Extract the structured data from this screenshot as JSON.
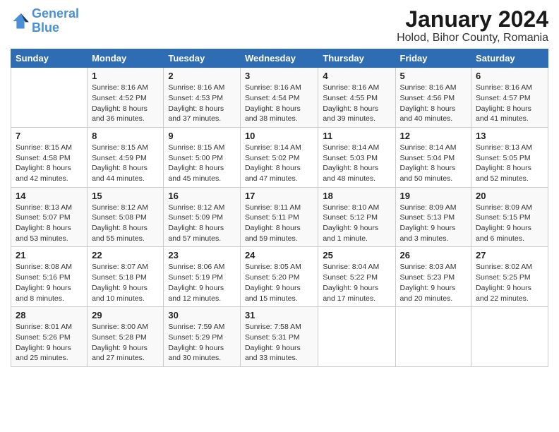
{
  "logo": {
    "line1": "General",
    "line2": "Blue"
  },
  "title": "January 2024",
  "subtitle": "Holod, Bihor County, Romania",
  "weekdays": [
    "Sunday",
    "Monday",
    "Tuesday",
    "Wednesday",
    "Thursday",
    "Friday",
    "Saturday"
  ],
  "weeks": [
    [
      {
        "day": "",
        "info": ""
      },
      {
        "day": "1",
        "info": "Sunrise: 8:16 AM\nSunset: 4:52 PM\nDaylight: 8 hours\nand 36 minutes."
      },
      {
        "day": "2",
        "info": "Sunrise: 8:16 AM\nSunset: 4:53 PM\nDaylight: 8 hours\nand 37 minutes."
      },
      {
        "day": "3",
        "info": "Sunrise: 8:16 AM\nSunset: 4:54 PM\nDaylight: 8 hours\nand 38 minutes."
      },
      {
        "day": "4",
        "info": "Sunrise: 8:16 AM\nSunset: 4:55 PM\nDaylight: 8 hours\nand 39 minutes."
      },
      {
        "day": "5",
        "info": "Sunrise: 8:16 AM\nSunset: 4:56 PM\nDaylight: 8 hours\nand 40 minutes."
      },
      {
        "day": "6",
        "info": "Sunrise: 8:16 AM\nSunset: 4:57 PM\nDaylight: 8 hours\nand 41 minutes."
      }
    ],
    [
      {
        "day": "7",
        "info": "Sunrise: 8:15 AM\nSunset: 4:58 PM\nDaylight: 8 hours\nand 42 minutes."
      },
      {
        "day": "8",
        "info": "Sunrise: 8:15 AM\nSunset: 4:59 PM\nDaylight: 8 hours\nand 44 minutes."
      },
      {
        "day": "9",
        "info": "Sunrise: 8:15 AM\nSunset: 5:00 PM\nDaylight: 8 hours\nand 45 minutes."
      },
      {
        "day": "10",
        "info": "Sunrise: 8:14 AM\nSunset: 5:02 PM\nDaylight: 8 hours\nand 47 minutes."
      },
      {
        "day": "11",
        "info": "Sunrise: 8:14 AM\nSunset: 5:03 PM\nDaylight: 8 hours\nand 48 minutes."
      },
      {
        "day": "12",
        "info": "Sunrise: 8:14 AM\nSunset: 5:04 PM\nDaylight: 8 hours\nand 50 minutes."
      },
      {
        "day": "13",
        "info": "Sunrise: 8:13 AM\nSunset: 5:05 PM\nDaylight: 8 hours\nand 52 minutes."
      }
    ],
    [
      {
        "day": "14",
        "info": "Sunrise: 8:13 AM\nSunset: 5:07 PM\nDaylight: 8 hours\nand 53 minutes."
      },
      {
        "day": "15",
        "info": "Sunrise: 8:12 AM\nSunset: 5:08 PM\nDaylight: 8 hours\nand 55 minutes."
      },
      {
        "day": "16",
        "info": "Sunrise: 8:12 AM\nSunset: 5:09 PM\nDaylight: 8 hours\nand 57 minutes."
      },
      {
        "day": "17",
        "info": "Sunrise: 8:11 AM\nSunset: 5:11 PM\nDaylight: 8 hours\nand 59 minutes."
      },
      {
        "day": "18",
        "info": "Sunrise: 8:10 AM\nSunset: 5:12 PM\nDaylight: 9 hours\nand 1 minute."
      },
      {
        "day": "19",
        "info": "Sunrise: 8:09 AM\nSunset: 5:13 PM\nDaylight: 9 hours\nand 3 minutes."
      },
      {
        "day": "20",
        "info": "Sunrise: 8:09 AM\nSunset: 5:15 PM\nDaylight: 9 hours\nand 6 minutes."
      }
    ],
    [
      {
        "day": "21",
        "info": "Sunrise: 8:08 AM\nSunset: 5:16 PM\nDaylight: 9 hours\nand 8 minutes."
      },
      {
        "day": "22",
        "info": "Sunrise: 8:07 AM\nSunset: 5:18 PM\nDaylight: 9 hours\nand 10 minutes."
      },
      {
        "day": "23",
        "info": "Sunrise: 8:06 AM\nSunset: 5:19 PM\nDaylight: 9 hours\nand 12 minutes."
      },
      {
        "day": "24",
        "info": "Sunrise: 8:05 AM\nSunset: 5:20 PM\nDaylight: 9 hours\nand 15 minutes."
      },
      {
        "day": "25",
        "info": "Sunrise: 8:04 AM\nSunset: 5:22 PM\nDaylight: 9 hours\nand 17 minutes."
      },
      {
        "day": "26",
        "info": "Sunrise: 8:03 AM\nSunset: 5:23 PM\nDaylight: 9 hours\nand 20 minutes."
      },
      {
        "day": "27",
        "info": "Sunrise: 8:02 AM\nSunset: 5:25 PM\nDaylight: 9 hours\nand 22 minutes."
      }
    ],
    [
      {
        "day": "28",
        "info": "Sunrise: 8:01 AM\nSunset: 5:26 PM\nDaylight: 9 hours\nand 25 minutes."
      },
      {
        "day": "29",
        "info": "Sunrise: 8:00 AM\nSunset: 5:28 PM\nDaylight: 9 hours\nand 27 minutes."
      },
      {
        "day": "30",
        "info": "Sunrise: 7:59 AM\nSunset: 5:29 PM\nDaylight: 9 hours\nand 30 minutes."
      },
      {
        "day": "31",
        "info": "Sunrise: 7:58 AM\nSunset: 5:31 PM\nDaylight: 9 hours\nand 33 minutes."
      },
      {
        "day": "",
        "info": ""
      },
      {
        "day": "",
        "info": ""
      },
      {
        "day": "",
        "info": ""
      }
    ]
  ]
}
